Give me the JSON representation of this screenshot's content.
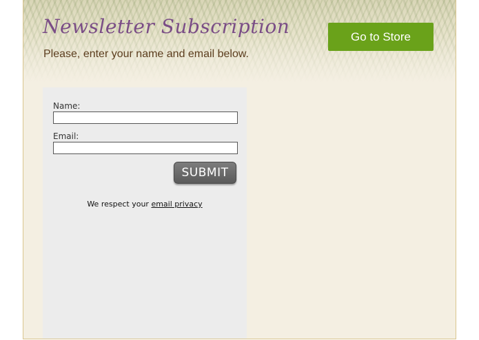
{
  "header": {
    "title": "Newsletter Subscription",
    "subtitle": "Please, enter your name and email below.",
    "store_button": "Go to Store"
  },
  "form": {
    "name_label": "Name:",
    "name_value": "",
    "email_label": "Email:",
    "email_value": "",
    "submit_label": "SUBMIT",
    "privacy_text": "We respect your",
    "privacy_link": "email privacy"
  },
  "colors": {
    "title": "#7a4d86",
    "subtitle": "#5c3d1e",
    "store_button": "#6aa21a",
    "submit_button": "#666666",
    "panel": "#ececec",
    "background": "#f4efe2",
    "frame_border": "#d9c58e"
  }
}
